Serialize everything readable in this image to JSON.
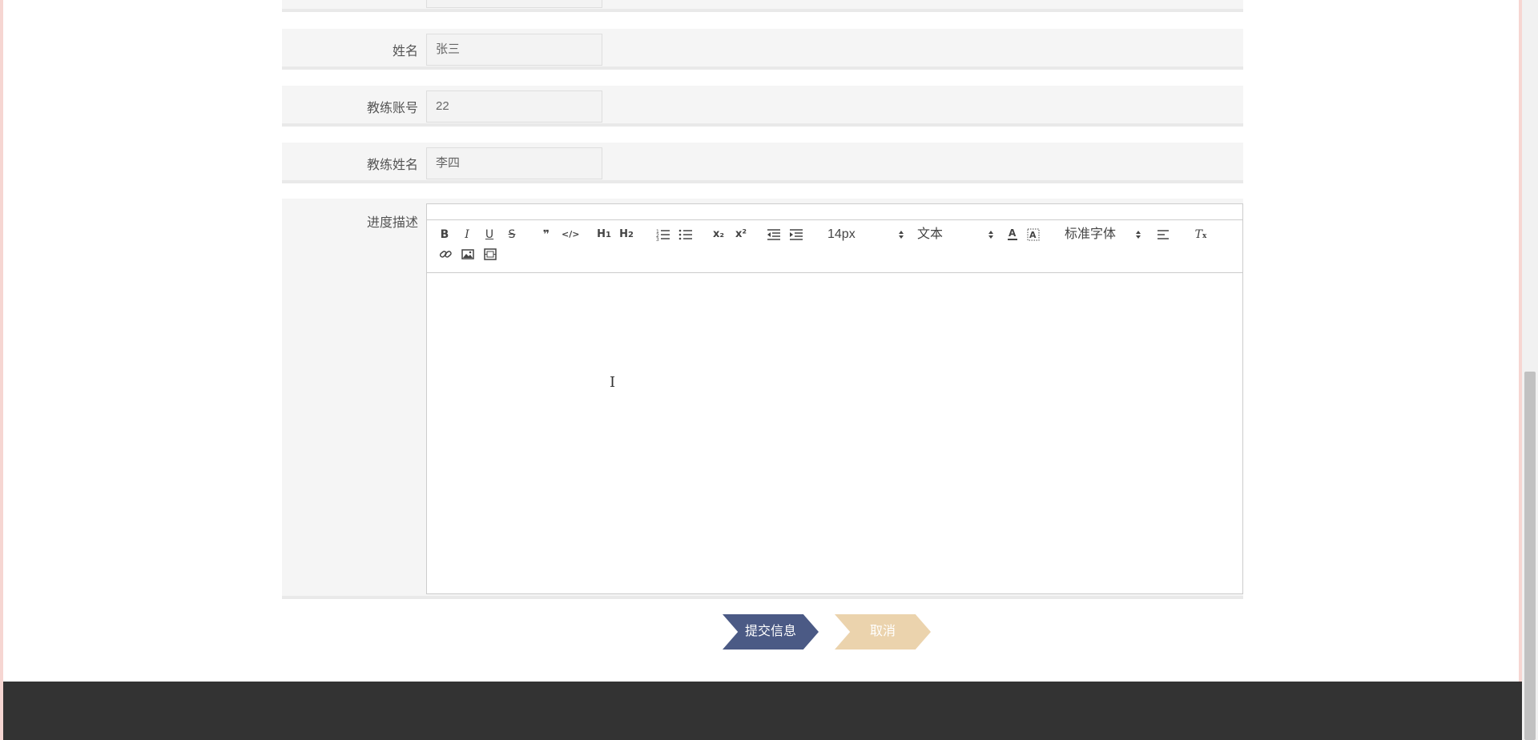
{
  "form": {
    "fields": [
      {
        "label": "姓名",
        "value": "张三"
      },
      {
        "label": "教练账号",
        "value": "22"
      },
      {
        "label": "教练姓名",
        "value": "李四"
      }
    ],
    "description_label": "进度描述"
  },
  "editor": {
    "toolbar": {
      "bold": "B",
      "italic": "I",
      "underline": "U",
      "strike": "S",
      "blockquote": "❞",
      "code": "</>",
      "h1": "H1",
      "h2": "H2",
      "ordered_list": "ordered-list-icon",
      "bullet_list": "bullet-list-icon",
      "subscript": "x₂",
      "superscript": "x²",
      "outdent": "outdent-icon",
      "indent": "indent-icon",
      "size_value": "14px",
      "header_value": "文本",
      "font_value": "标准字体",
      "clean": "Tx"
    },
    "content": ""
  },
  "buttons": {
    "submit_label": "提交信息",
    "cancel_label": "取消"
  },
  "colors": {
    "submit": "#4b5a85",
    "cancel": "#ebd3ad",
    "footer": "#333333",
    "row_bg": "#f5f5f5"
  }
}
